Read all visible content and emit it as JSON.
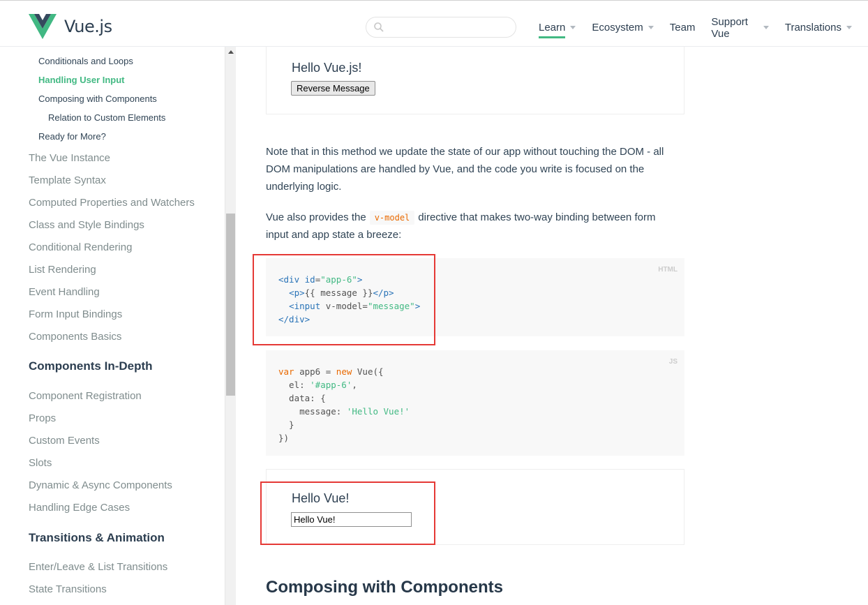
{
  "header": {
    "logo_text": "Vue.js",
    "search_placeholder": "",
    "nav": [
      {
        "label": "Learn",
        "dropdown": true,
        "active": true
      },
      {
        "label": "Ecosystem",
        "dropdown": true
      },
      {
        "label": "Team",
        "dropdown": false
      },
      {
        "label": "Support Vue",
        "dropdown": true
      },
      {
        "label": "Translations",
        "dropdown": true
      }
    ]
  },
  "sidebar": {
    "sub_items": [
      "Conditionals and Loops",
      "Handling User Input",
      "Composing with Components",
      "Relation to Custom Elements",
      "Ready for More?"
    ],
    "links": [
      "The Vue Instance",
      "Template Syntax",
      "Computed Properties and Watchers",
      "Class and Style Bindings",
      "Conditional Rendering",
      "List Rendering",
      "Event Handling",
      "Form Input Bindings",
      "Components Basics"
    ],
    "section_depth": "Components In-Depth",
    "depth_links": [
      "Component Registration",
      "Props",
      "Custom Events",
      "Slots",
      "Dynamic & Async Components",
      "Handling Edge Cases"
    ],
    "section_transitions": "Transitions & Animation",
    "transition_links": [
      "Enter/Leave & List Transitions",
      "State Transitions"
    ]
  },
  "content": {
    "demo1": {
      "text": "Hello Vue.js!",
      "button": "Reverse Message"
    },
    "para1": "Note that in this method we update the state of our app without touching the DOM - all DOM manipulations are handled by Vue, and the code you write is focused on the underlying logic.",
    "para2_before": "Vue also provides the",
    "para2_code": "v-model",
    "para2_after": "directive that makes two-way binding between form input and app state a breeze:",
    "code_html_lang": "HTML",
    "code_js_lang": "JS",
    "demo2": {
      "text": "Hello Vue!",
      "input_value": "Hello Vue!"
    },
    "section_title": "Composing with Components"
  },
  "colors": {
    "accent": "#42b983",
    "highlight": "#e53935"
  }
}
